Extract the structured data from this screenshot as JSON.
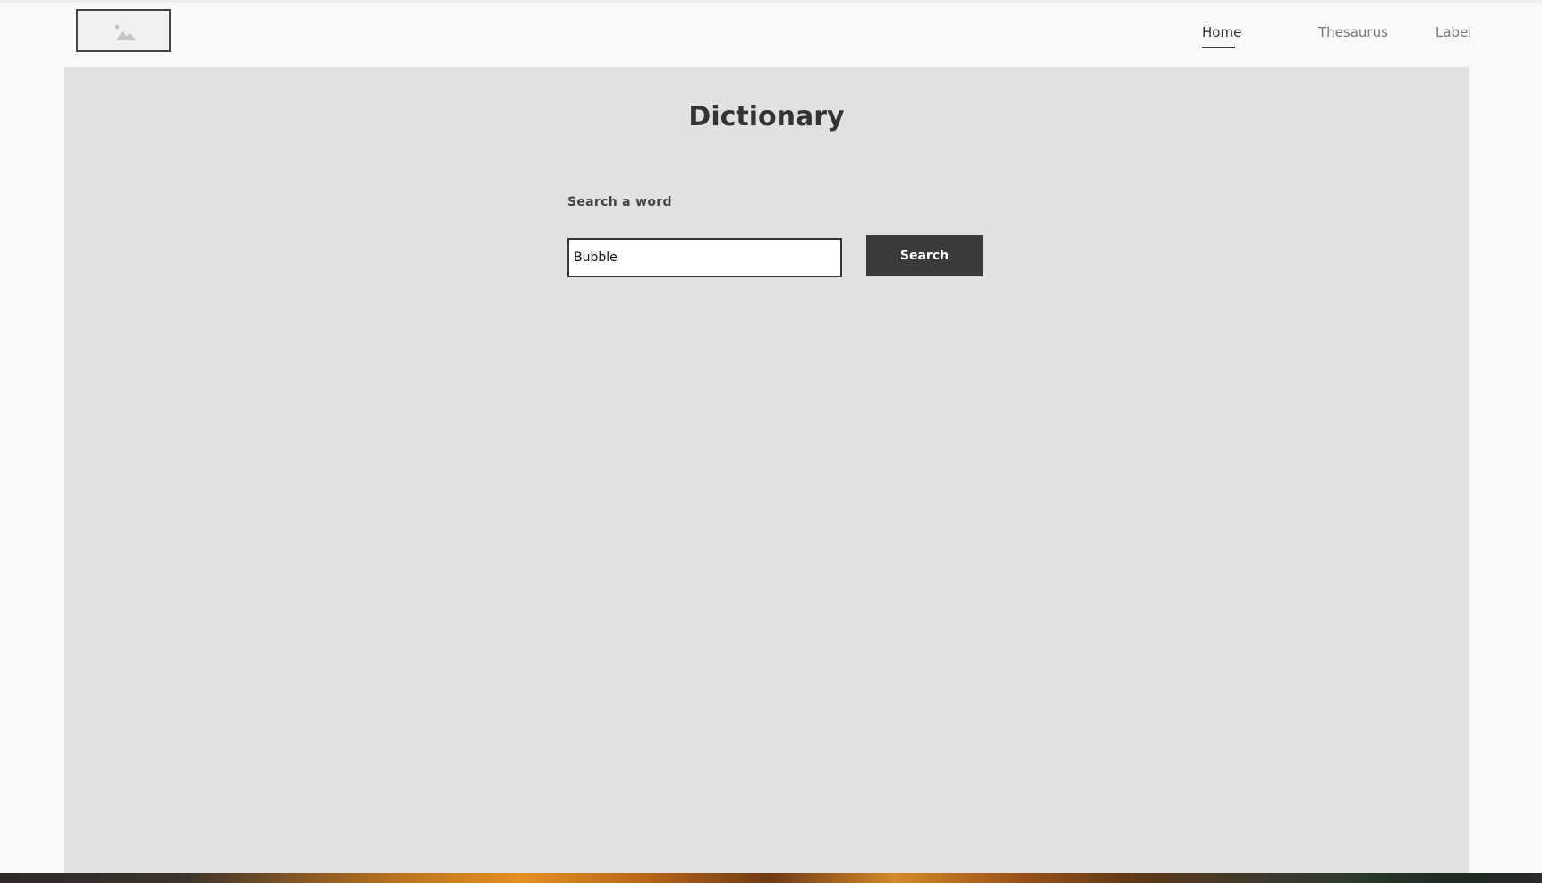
{
  "nav": {
    "logo": "image-placeholder-icon",
    "items": [
      {
        "label": "Home",
        "active": true
      },
      {
        "label": "Thesaurus",
        "active": false
      },
      {
        "label": "Label",
        "active": false
      }
    ]
  },
  "main": {
    "title": "Dictionary",
    "search_label": "Search a word",
    "search_value": "Bubble",
    "search_button": "Search"
  },
  "colors": {
    "page_background": "#fafafa",
    "panel_background": "#e2e1df",
    "button_background": "#3a3a3a",
    "text_primary": "#333333",
    "nav_inactive": "#777777"
  }
}
